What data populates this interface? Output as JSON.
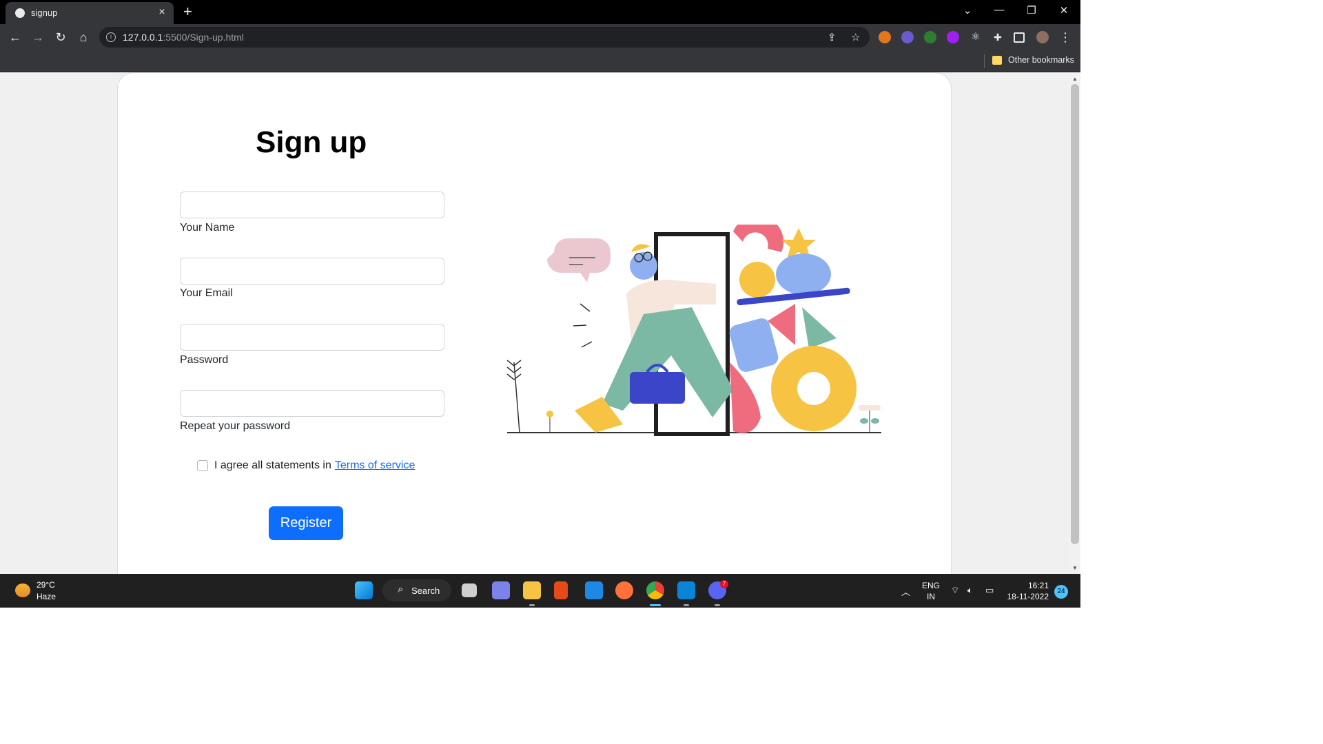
{
  "browser": {
    "tab_title": "signup",
    "tab_close": "×",
    "new_tab": "+",
    "url_host": "127.0.0.1",
    "url_path": ":5500/Sign-up.html",
    "other_bookmarks": "Other bookmarks"
  },
  "page": {
    "heading": "Sign up",
    "fields": [
      {
        "label": "Your Name",
        "value": ""
      },
      {
        "label": "Your Email",
        "value": ""
      },
      {
        "label": "Password",
        "value": ""
      },
      {
        "label": "Repeat your password",
        "value": ""
      }
    ],
    "agree_text": "I agree all statements in",
    "terms_link": "Terms of service",
    "register_button": "Register"
  },
  "taskbar": {
    "temperature": "29°C",
    "condition": "Haze",
    "search_label": "Search",
    "lang_line1": "ENG",
    "lang_line2": "IN",
    "time": "16:21",
    "date": "18-11-2022",
    "notification_count": "24",
    "discord_badge": "7"
  },
  "colors": {
    "accent": "#0d6efd",
    "chrome_dark": "#35363a",
    "taskbar": "#202020"
  }
}
